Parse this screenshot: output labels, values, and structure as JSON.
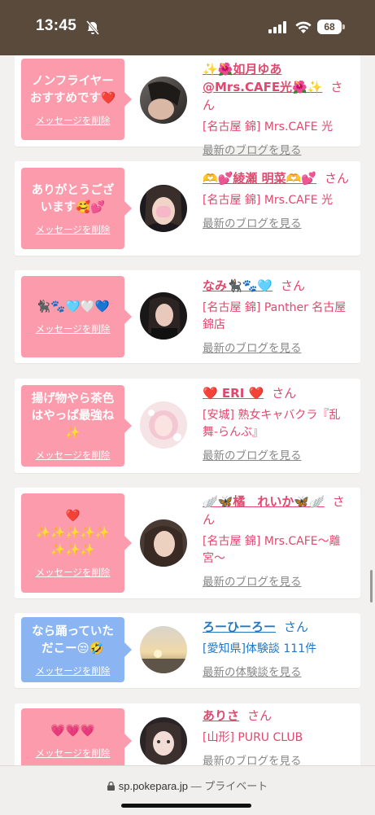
{
  "status_bar": {
    "time": "13:45",
    "battery": "68"
  },
  "feed": [
    {
      "message": "ノンフライヤーおすすめです❤️",
      "delete": "メッセージを削除",
      "name": "✨🌺如月ゆあ@Mrs.CAFE光🌺✨",
      "san": "さん",
      "shop": "[名古屋 錦] Mrs.CAFE 光",
      "link": "最新のブログを見る"
    },
    {
      "message": "ありがとうございます🥰💕",
      "delete": "メッセージを削除",
      "name": "🫶💕綾瀬 明菜🫶💕",
      "san": "さん",
      "shop": "[名古屋 錦] Mrs.CAFE 光",
      "link": "最新のブログを見る"
    },
    {
      "message": "🐈‍⬛🐾🩵🤍💙",
      "delete": "メッセージを削除",
      "name": "なみ🐈‍⬛🐾🩵",
      "san": "さん",
      "shop": "[名古屋 錦] Panther 名古屋錦店",
      "link": "最新のブログを見る"
    },
    {
      "message": "揚げ物やら茶色はやっぱ最強ね✨",
      "delete": "メッセージを削除",
      "name": "❤️ ERI ❤️",
      "san": "さん",
      "shop": "[安城] 熟女キャバクラ『乱舞-らんぶ』",
      "link": "最新のブログを見る"
    },
    {
      "message": "❤️ ✨✨✨✨✨ ✨✨✨",
      "delete": "メッセージを削除",
      "name": "🪽🦋橘　れいか🦋🪽",
      "san": "さん",
      "shop": "[名古屋 錦] Mrs.CAFE〜離宮〜",
      "link": "最新のブログを見る"
    },
    {
      "message": "なら踊っていただこー😒🤣",
      "delete": "メッセージを削除",
      "name": "ろーひーろー",
      "san": "さん",
      "shop": "[愛知県]体験談 111件",
      "link": "最新の体験談を見る"
    },
    {
      "message": "💗💗💗",
      "delete": "メッセージを削除",
      "name": "ありさ",
      "san": "さん",
      "shop": "[山形] PURU CLUB",
      "link": "最新のブログを見る"
    }
  ],
  "browser": {
    "url": "sp.pokepara.jp",
    "separator": " — ",
    "mode": "プライベート"
  },
  "colors": {
    "accent": "#e0486e",
    "bubble_pink": "#fc9bab",
    "bubble_blue": "#8ab5f2",
    "link_blue": "#2677c1",
    "status_bar": "#5a4a3c"
  }
}
